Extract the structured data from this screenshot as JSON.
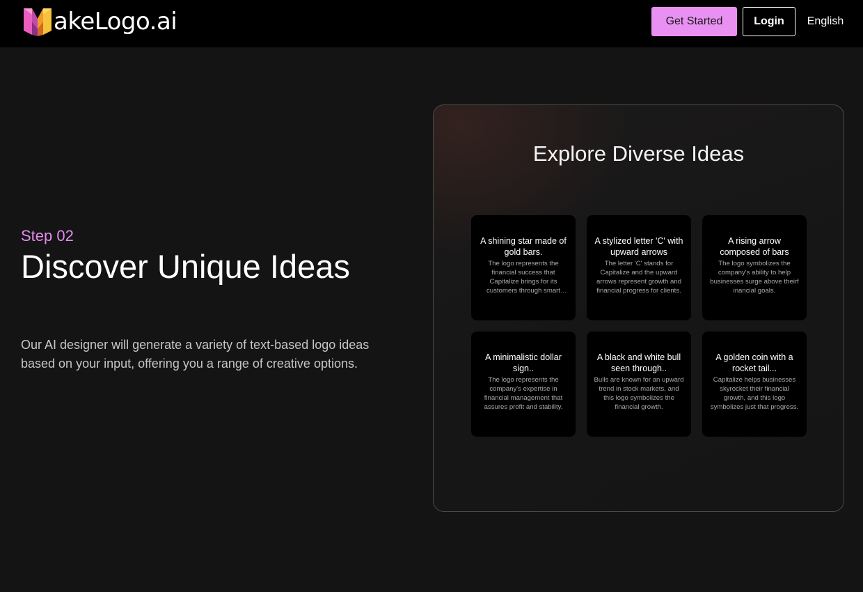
{
  "header": {
    "brand_text": "akeLogo.ai",
    "get_started_label": "Get Started",
    "login_label": "Login",
    "language_label": "English"
  },
  "hero": {
    "step_label": "Step 02",
    "title": "Discover Unique Ideas",
    "description": "Our AI designer will generate a variety of text-based logo ideas based on your input, offering you a range of creative options."
  },
  "panel": {
    "title": "Explore Diverse Ideas",
    "cards": [
      {
        "title": "A shining star made of gold bars.",
        "description": "The logo represents the financial success that Capitalize brings for its customers through smart investments."
      },
      {
        "title": "A stylized letter 'C' with upward arrows",
        "description": "The letter 'C' stands for Capitalize and the upward arrows represent growth and financial progress for clients."
      },
      {
        "title": "A rising arrow composed of bars",
        "description": "The logo symbolizes the company's ability to help businesses surge above theirf inancial goals."
      },
      {
        "title": "A minimalistic dollar sign..",
        "description": "The logo represents the company's expertise in financial management that assures profit and stability."
      },
      {
        "title": "A black and white bull seen through..",
        "description": "Bulls are known for an upward trend in stock markets, and this logo symbolizes the financial growth."
      },
      {
        "title": "A golden coin with a rocket tail...",
        "description": "Capitalize helps businesses skyrocket their financial growth, and this logo symbolizes just that progress."
      }
    ]
  },
  "colors": {
    "accent": "#e891f2",
    "step_label": "#e48cf0",
    "page_background": "#141414",
    "header_background": "#000000"
  }
}
